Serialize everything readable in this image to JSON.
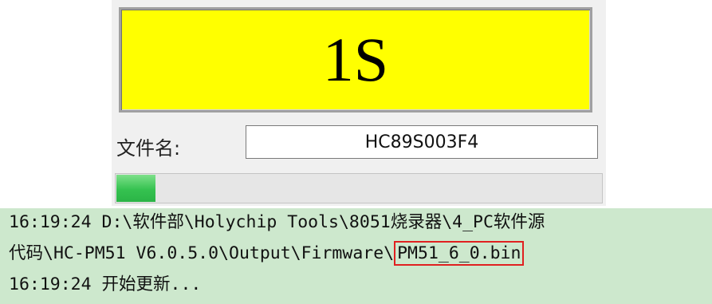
{
  "status": {
    "text": "1S",
    "background": "#ffff00"
  },
  "file": {
    "label": "文件名:",
    "value": "HC89S003F4"
  },
  "progress": {
    "fraction": 0.08,
    "color": "#35c250"
  },
  "log": {
    "line1": "16:19:24 D:\\软件部\\Holychip Tools\\8051烧录器\\4_PC软件源",
    "line2_prefix": "代码\\HC-PM51 V6.0.5.0\\Output\\Firmware\\",
    "line2_highlight": "PM51_6_0.bin",
    "line3": "16:19:24 开始更新...",
    "highlight_color": "#e02020",
    "background": "#cde8cd"
  }
}
